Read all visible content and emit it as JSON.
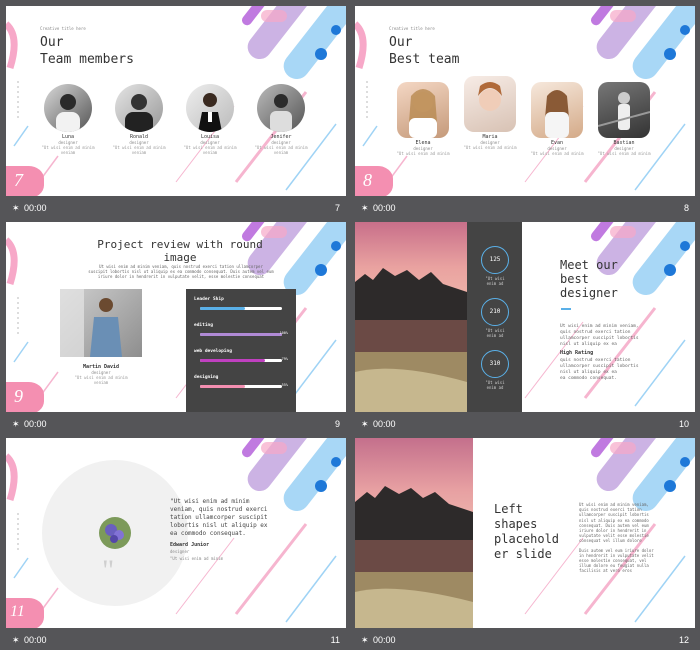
{
  "colors": {
    "pink": "#f48fb1",
    "purple": "#b08ad6",
    "blue": "#5ab0e8",
    "dark": "#444444",
    "bg": "#555558"
  },
  "slides": [
    {
      "time": "00:00",
      "num": "7",
      "badge": "7",
      "kicker": "Creative title here",
      "title1": "Our",
      "title2": "Team members",
      "members": [
        {
          "name": "Luna",
          "role": "designer",
          "desc1": "\"Ut wisi enim ad minim",
          "desc2": "veniam"
        },
        {
          "name": "Ronald",
          "role": "designer",
          "desc1": "\"Ut wisi enim ad minim",
          "desc2": "veniam"
        },
        {
          "name": "Louisa",
          "role": "designer",
          "desc1": "\"Ut wisi enim ad minim",
          "desc2": "veniam"
        },
        {
          "name": "Jenifer",
          "role": "designer",
          "desc1": "\"Ut wisi enim ad minim",
          "desc2": "veniam"
        }
      ]
    },
    {
      "time": "00:00",
      "num": "8",
      "badge": "8",
      "kicker": "Creative title here",
      "title1": "Our",
      "title2": "Best team",
      "members": [
        {
          "name": "Elena",
          "role": "designer",
          "desc": "\"Ut wisi enim ad minim"
        },
        {
          "name": "Maria",
          "role": "designer",
          "desc": "\"Ut wisi enim ad minim"
        },
        {
          "name": "Evan",
          "role": "designer",
          "desc": "\"Ut wisi enim ad minim"
        },
        {
          "name": "Bastian",
          "role": "designer",
          "desc": "\"Ut wisi enim ad minim"
        }
      ]
    },
    {
      "time": "00:00",
      "num": "9",
      "badge": "9",
      "title1": "Project review with round",
      "title2": "image",
      "body1": "Ut wisi enim ad minim veniam, quis nostrud exerci tation ullamcorper",
      "body2": "suscipit lobortis nisl ut aliquip ex ea commodo consequat. Duis autem vel eum",
      "body3": "iriure dolor in hendrerit in vulputate velit, esse molestie consequat",
      "person": "Martin David",
      "person_role": "designer",
      "person_desc1": "\"Ut wisi enim ad minim",
      "person_desc2": "veniam",
      "skills": [
        {
          "label": "Leader Ship",
          "pct": "",
          "value": 0.55
        },
        {
          "label": "editing",
          "pct": "100%",
          "value": 1.0
        },
        {
          "label": "web developing",
          "pct": "79%",
          "value": 0.79
        },
        {
          "label": "designing",
          "pct": "55%",
          "value": 0.55
        }
      ]
    },
    {
      "time": "00:00",
      "num": "10",
      "rings": [
        {
          "value": "125",
          "cap1": "\"Ut wisi",
          "cap2": "enim ad"
        },
        {
          "value": "210",
          "cap1": "\"Ut wisi",
          "cap2": "enim ad"
        },
        {
          "value": "310",
          "cap1": "\"Ut wisi",
          "cap2": "enim ad"
        }
      ],
      "title1": "Meet our",
      "title2": "best",
      "title3": "designer",
      "p1a": "Ut wisi enim ad minim veniam,",
      "p1b": "quis nostrud exerci tation",
      "p1c": "ullamcorper suscipit lobortis",
      "p1d": "nisl ut aliquip ex ea",
      "rating": "High Rating",
      "p2a": "quis nostrud exerci tation",
      "p2b": "ullamcorper suscipit lobortis",
      "p2c": "nisl ut aliquip ex ea",
      "p2d": "ea commodo consequat."
    },
    {
      "time": "00:00",
      "num": "11",
      "badge": "11",
      "quote_mark": "\"",
      "q1": "\"Ut wisi enim ad minim",
      "q2": "veniam, quis nostrud exerci",
      "q3": "tation ullamcorper suscipit",
      "q4": "lobortis nisl ut aliquip ex",
      "q5": "ea commodo consequat.",
      "author": "Edward Junior",
      "author_role": "designer",
      "author_desc": "\"Ut wisi enim ad minim"
    },
    {
      "time": "00:00",
      "num": "12",
      "title1": "Left",
      "title2": "shapes",
      "title3": "placehold",
      "title4": "er slide",
      "c1": "Ut wisi enim ad minim veniam,",
      "c2": "quis nostrud exerci tation",
      "c3": "ullamcorper suscipit lobortis",
      "c4": "nisl ut aliquip ex ea commodo",
      "c5": "consequat. Duis autem vel eum",
      "c6": "iriure dolor in hendrerit in",
      "c7": "vulputate velit esse molestie",
      "c8": "consequat vel illum dolore",
      "c9": "Duis autem vel eum iriure dolor",
      "c10": "in hendrerit in vulputate velit",
      "c11": "esse molestie consequat, vel",
      "c12": "illum dolore eu feugiat nulla",
      "c13": "facilisis at vero eros"
    }
  ]
}
